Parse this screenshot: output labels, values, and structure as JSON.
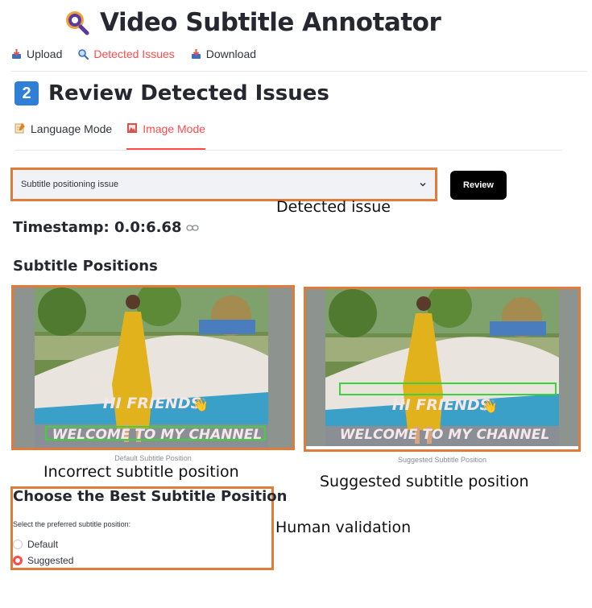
{
  "app": {
    "title": "Video Subtitle Annotator"
  },
  "top_tabs": [
    {
      "label": "Upload",
      "icon": "inbox-tray-icon",
      "active": false
    },
    {
      "label": "Detected Issues",
      "icon": "magnifier-icon",
      "active": true
    },
    {
      "label": "Download",
      "icon": "inbox-tray-icon",
      "active": false
    }
  ],
  "section": {
    "number": "2",
    "title": "Review Detected Issues"
  },
  "mode_tabs": [
    {
      "label": "Language Mode",
      "icon": "memo-icon",
      "active": false
    },
    {
      "label": "Image Mode",
      "icon": "framed-picture-icon",
      "active": true
    }
  ],
  "issue_select": {
    "value": "Subtitle positioning issue"
  },
  "review_button": {
    "label": "Review"
  },
  "timestamp": {
    "label": "Timestamp: 0.0:6.68"
  },
  "subtitle_positions": {
    "heading": "Subtitle Positions",
    "subtitle_line1": "HI FRIENDS",
    "subtitle_line2": "WELCOME TO MY CHANNEL",
    "default_caption": "Default Subtitle Position",
    "suggested_caption": "Suggested Subtitle Position"
  },
  "choose": {
    "heading": "Choose the Best Subtitle Position",
    "label": "Select the preferred subtitle position:",
    "options": [
      "Default",
      "Suggested"
    ],
    "selected": "Suggested"
  },
  "annotations": {
    "detected_issue": "Detected issue",
    "incorrect_position": "Incorrect subtitle position",
    "suggested_position": "Suggested subtitle position",
    "human_validation": "Human validation"
  },
  "colors": {
    "accent": "#ff4b4b",
    "annotation_box": "#e07b39",
    "highlight_box": "#3cd23c",
    "badge": "#2f7fd6"
  }
}
